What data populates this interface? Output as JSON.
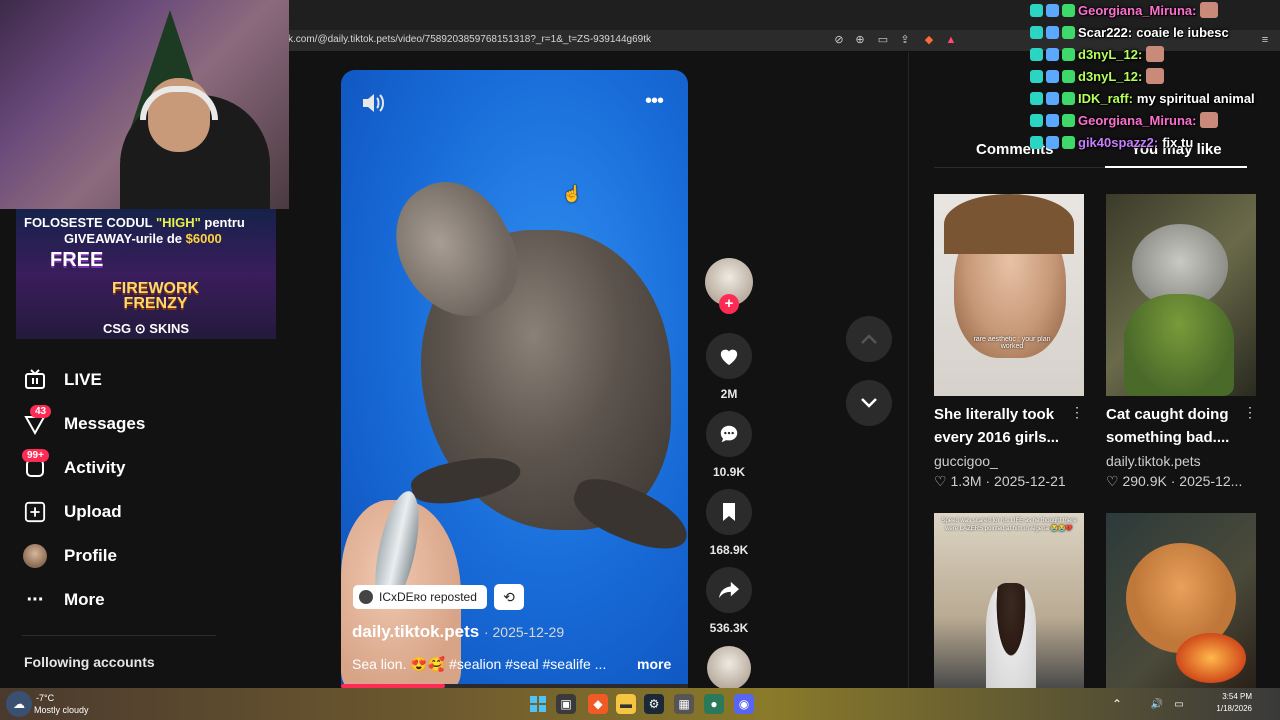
{
  "browser": {
    "url": "k.com/@daily.tiktok.pets/video/7589203859768151318?_r=1&_t=ZS-939144g69tk"
  },
  "ad": {
    "line1_pre": "FOLOSESTE CODUL ",
    "line1_code": "\"HIGH\"",
    "line1_post": " pentru",
    "line2_pre": "GIVEAWAY-urile de ",
    "line2_amount": "$6000",
    "free": "FREE",
    "firework": "FIREWORK\nFRENZY",
    "brand": "CSG ⊙ SKINS"
  },
  "sidebar": {
    "items": [
      {
        "label": "LIVE",
        "icon": "live-icon"
      },
      {
        "label": "Messages",
        "icon": "messages-icon",
        "badge": "43"
      },
      {
        "label": "Activity",
        "icon": "activity-icon",
        "badge": "99+"
      },
      {
        "label": "Upload",
        "icon": "upload-icon"
      },
      {
        "label": "Profile",
        "icon": "profile-avatar"
      },
      {
        "label": "More",
        "icon": "more-dots-icon"
      }
    ],
    "following_heading": "Following accounts"
  },
  "video": {
    "repost_user": "ICxDEʀᴏ",
    "repost_label": "reposted",
    "author": "daily.tiktok.pets",
    "date": "2025-12-29",
    "caption": "Sea lion. 😍🥰 #sealion #seal #sealife ...",
    "more_label": "more",
    "progress": 0.3
  },
  "actions": {
    "likes": "2M",
    "comments": "10.9K",
    "saves": "168.9K",
    "shares": "536.3K"
  },
  "panel": {
    "tab_comments": "Comments",
    "tab_you_may_like": "You may like",
    "recommendations": [
      {
        "title": "She literally took every 2016 girls...",
        "author": "guccigoo_",
        "likes": "1.3M",
        "date": "2025-12-21",
        "overlay_text": "rare aesthetic : your plan worked"
      },
      {
        "title": "Cat caught doing something bad....",
        "author": "daily.tiktok.pets",
        "likes": "290.9K",
        "date": "2025-12..."
      },
      {
        "overlay_text": "Speed was scared for his LIFE as he thought there were LAZERS pointed at him in Algeria 😭😭💔"
      },
      {}
    ]
  },
  "chat": [
    {
      "user": "Georgiana_Miruna:",
      "msg": "",
      "color": "#ff6fd0"
    },
    {
      "user": "Scar222:",
      "msg": "coaie le iubesc",
      "color": "#ffffff"
    },
    {
      "user": "d3nyL_12:",
      "msg": "",
      "color": "#b6ff5a"
    },
    {
      "user": "d3nyL_12:",
      "msg": "",
      "color": "#b6ff5a"
    },
    {
      "user": "IDK_raff:",
      "msg": "my spiritual animal",
      "color": "#b6ff5a"
    },
    {
      "user": "Georgiana_Miruna:",
      "msg": "",
      "color": "#ff6fd0"
    },
    {
      "user": "gik40spazz2:",
      "msg": "fix tu",
      "color": "#c77dff"
    }
  ],
  "taskbar": {
    "weather_temp": "-7°C",
    "weather_desc": "Mostly cloudy",
    "time": "3:54 PM",
    "date": "1/18/2026"
  },
  "colors": {
    "accent": "#fe2c55",
    "background": "#121212"
  }
}
